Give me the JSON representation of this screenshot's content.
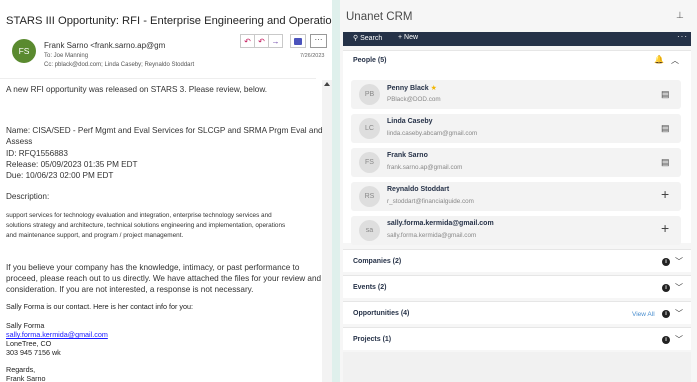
{
  "email": {
    "subject": "STARS III Opportunity: RFI - Enterprise Engineering and Operations Services",
    "avatar_initials": "FS",
    "from": "Frank Sarno <frank.sarno.ap@gm",
    "to": "To: Joe Manning",
    "cc": "Cc: pblack@dod.com; Linda Caseby; Reynaldo Stoddart",
    "date": "7/26/2023",
    "body": {
      "intro": "A new RFI opportunity was released on STARS 3. Please review, below.",
      "name_line1": "Name: CISA/SED - Perf Mgmt and Eval Services for SLCGP and SRMA Prgm Eval and",
      "name_line2": "Assess",
      "id": "ID: RFQ1556883",
      "release": "Release: 05/09/2023 01:35 PM EDT",
      "due": "Due: 10/06/23 02:00 PM EDT",
      "description_label": "Description:",
      "desc_line1": "support services for technology evaluation and integration, enterprise technology services and",
      "desc_line2": "solutions strategy and architecture, technical solutions engineering and implementation, operations",
      "desc_line3": "and maintenance support, and program / project management.",
      "para_line1": "If you believe your company has the knowledge, intimacy, or past performance to",
      "para_line2": "proceed, please reach out to us directly. We have attached the files for your review and",
      "para_line3": "consideration. If you are not interested, a response is not necessary.",
      "contact_line": "Sally Forma is our contact.   Here is her contact info for you:",
      "sig_name": "Sally Forma",
      "sig_email": "sally.forma.kermida@gmail.com",
      "sig_city": "LoneTree, CO",
      "sig_phone": "303 945 7156 wk",
      "regards": "Regards,",
      "closing_name": "Frank Sarno"
    }
  },
  "crm": {
    "title": "Unanet CRM",
    "pin_icon": "pin-icon",
    "nav": {
      "search_label": "Search",
      "new_label": "New",
      "more": "···"
    },
    "people": {
      "title": "People (5)",
      "items": [
        {
          "initials": "PB",
          "name": "Penny Black",
          "email": "PBlack@DOD.com",
          "starred": true,
          "action": "log-icon"
        },
        {
          "initials": "LC",
          "name": "Linda Caseby",
          "email": "linda.caseby.abcam@gmail.com",
          "action": "log-icon"
        },
        {
          "initials": "FS",
          "name": "Frank Sarno",
          "email": "frank.sarno.ap@gmail.com",
          "action": "log-icon"
        },
        {
          "initials": "RS",
          "name": "Reynaldo Stoddart",
          "email": "r_stoddart@financialguide.com",
          "action": "plus-icon"
        },
        {
          "initials": "sa",
          "name": "sally.forma.kermida@gmail.com",
          "email": "sally.forma.kermida@gmail.com",
          "action": "plus-icon"
        }
      ]
    },
    "companies": {
      "title": "Companies (2)"
    },
    "events": {
      "title": "Events (2)"
    },
    "opportunities": {
      "title": "Opportunities (4)",
      "view_all": "View All"
    },
    "projects": {
      "title": "Projects (1)"
    },
    "colors": {
      "nav_bg": "#253248",
      "accent": "#4a8fcf",
      "bell": "#f0a500"
    }
  }
}
